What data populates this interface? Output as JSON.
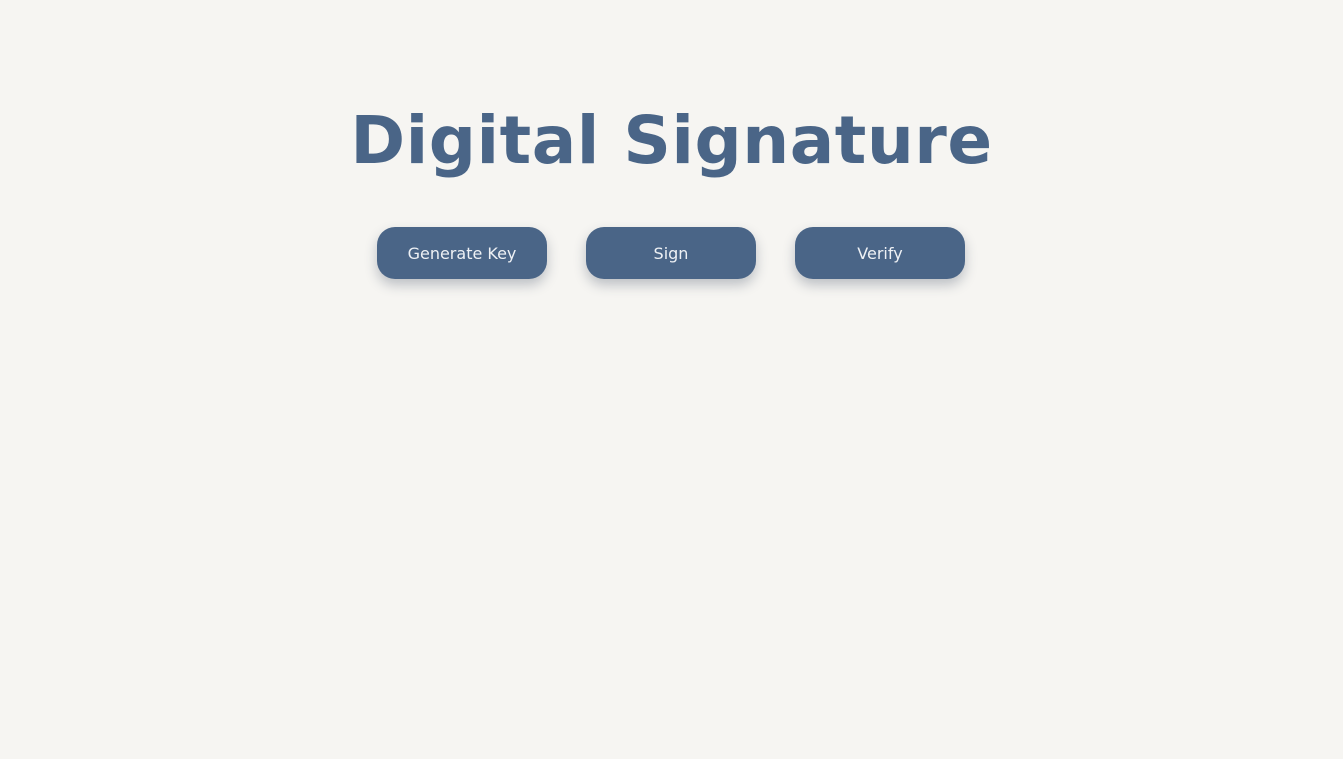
{
  "header": {
    "title": "Digital Signature"
  },
  "actions": {
    "generate_key_label": "Generate Key",
    "sign_label": "Sign",
    "verify_label": "Verify"
  },
  "colors": {
    "background": "#f6f5f2",
    "accent": "#4a6587",
    "button_text": "#eef1f5"
  }
}
